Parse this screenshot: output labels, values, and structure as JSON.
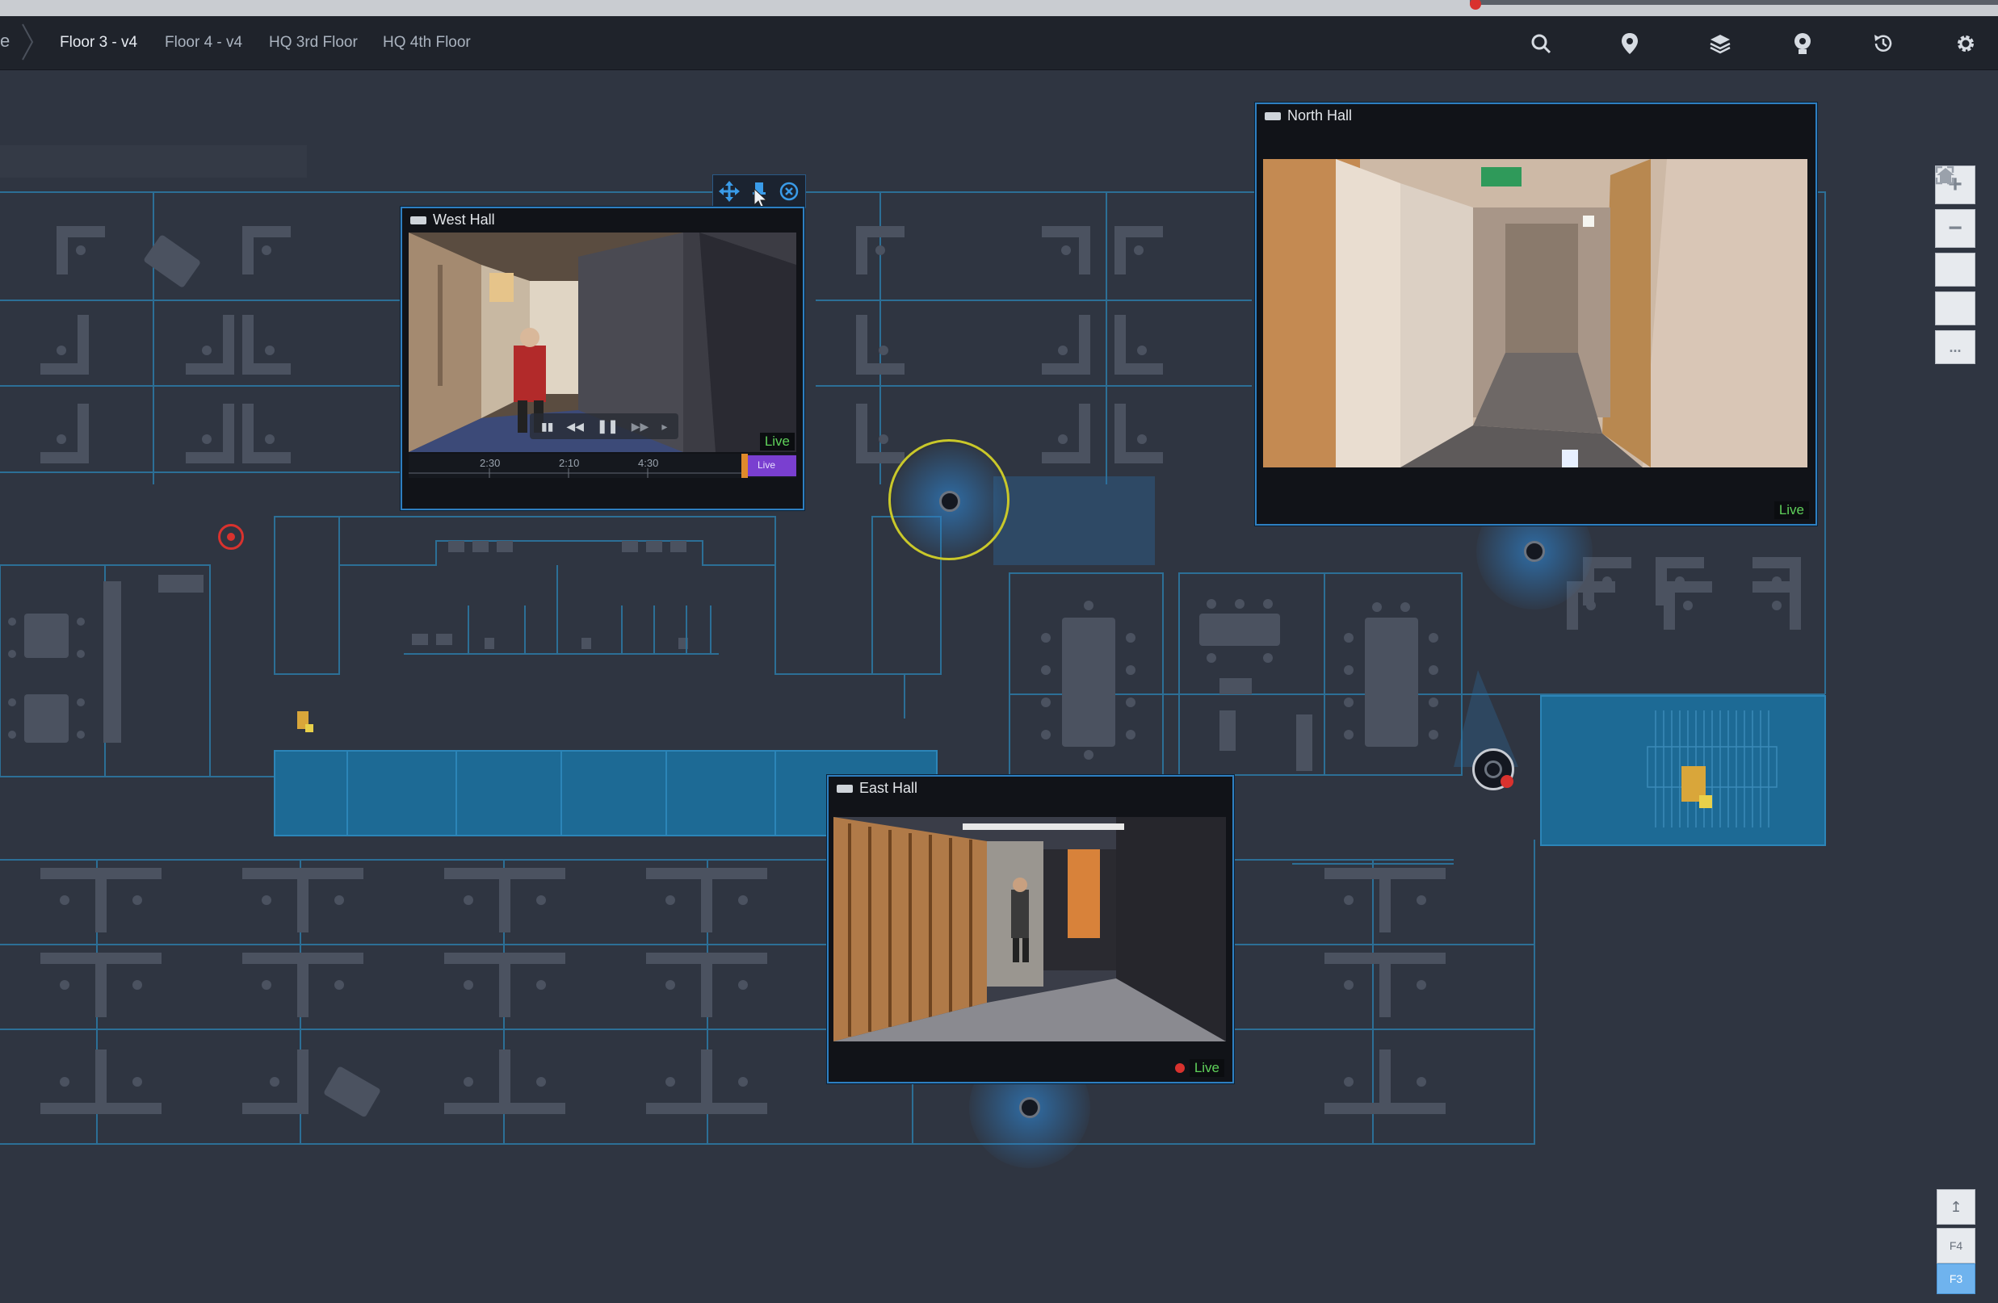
{
  "breadcrumb_fragment": "e",
  "tabs": [
    {
      "label": "Floor 3 - v4",
      "active": true
    },
    {
      "label": "Floor 4 - v4",
      "active": false
    },
    {
      "label": "HQ 3rd Floor",
      "active": false
    },
    {
      "label": "HQ 4th Floor",
      "active": false
    }
  ],
  "toolbar_icons": [
    "search-icon",
    "map-pin-icon",
    "layers-icon",
    "camera-icon",
    "history-icon",
    "gear-icon"
  ],
  "map_tools": {
    "zoom_in": "+",
    "zoom_out": "−",
    "more": "..."
  },
  "floor_tools": {
    "up": "↥",
    "f4": "F4",
    "f3": "F3"
  },
  "cameras": [
    {
      "id": "west",
      "title": "West Hall",
      "status": "Live",
      "timeline_labels": [
        "2:30",
        "2:10",
        "4:30"
      ],
      "live_tag": "Live"
    },
    {
      "id": "north",
      "title": "North Hall",
      "status": "Live"
    },
    {
      "id": "east",
      "title": "East Hall",
      "status": "Live",
      "recording": true
    }
  ],
  "colors": {
    "accent": "#2d8fe0",
    "live": "#5fd15a",
    "selection": "#c9c82a",
    "alarm": "#d9322e",
    "wall": "#2c6f96"
  }
}
